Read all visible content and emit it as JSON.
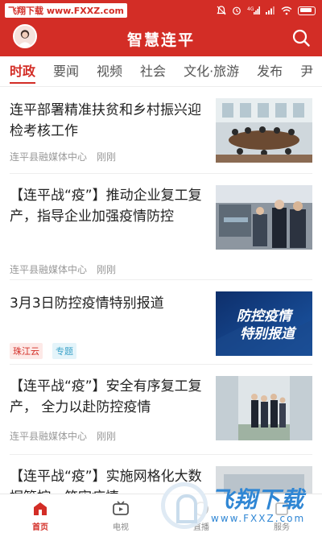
{
  "status_bar": {
    "watermark": "飞翔下载 www.FXXZ.com",
    "icons": [
      "dnd-icon",
      "alarm-icon",
      "signal-4g-icon",
      "signal-icon",
      "wifi-icon",
      "battery-icon"
    ]
  },
  "header": {
    "title": "智慧连平",
    "background_color": "#d32d26"
  },
  "tabs": [
    {
      "label": "时政",
      "active": true
    },
    {
      "label": "要闻",
      "active": false
    },
    {
      "label": "视频",
      "active": false
    },
    {
      "label": "社会",
      "active": false
    },
    {
      "label": "文化·旅游",
      "active": false
    },
    {
      "label": "发布",
      "active": false
    },
    {
      "label": "尹",
      "active": false
    }
  ],
  "feed": [
    {
      "title": "连平部署精准扶贫和乡村振兴迎检考核工作",
      "source": "连平县融媒体中心",
      "time": "刚刚"
    },
    {
      "title": "【连平战“疫”】推动企业复工复产，指导企业加强疫情防控",
      "source": "连平县融媒体中心",
      "time": "刚刚"
    },
    {
      "title": "3月3日防控疫情特别报道",
      "tags": [
        "珠江云",
        "专题"
      ],
      "thumb_text_line1": "防控疫情",
      "thumb_text_line2": "特别报道"
    },
    {
      "title": "【连平战“疫”】安全有序复工复产， 全力以赴防控疫情",
      "source": "连平县融媒体中心",
      "time": "刚刚"
    },
    {
      "title": "【连平战“疫”】实施网格化大数据管控，筑牢疫情"
    }
  ],
  "bottom_nav": [
    {
      "label": "首页",
      "icon": "home-icon",
      "active": true
    },
    {
      "label": "电视",
      "icon": "tv-icon",
      "active": false
    },
    {
      "label": "直播",
      "icon": "live-icon",
      "active": false
    },
    {
      "label": "服务",
      "icon": "service-icon",
      "active": false
    }
  ],
  "watermark_bottom": {
    "big": "飞翔下载",
    "small": "www.FXXZ.com"
  }
}
